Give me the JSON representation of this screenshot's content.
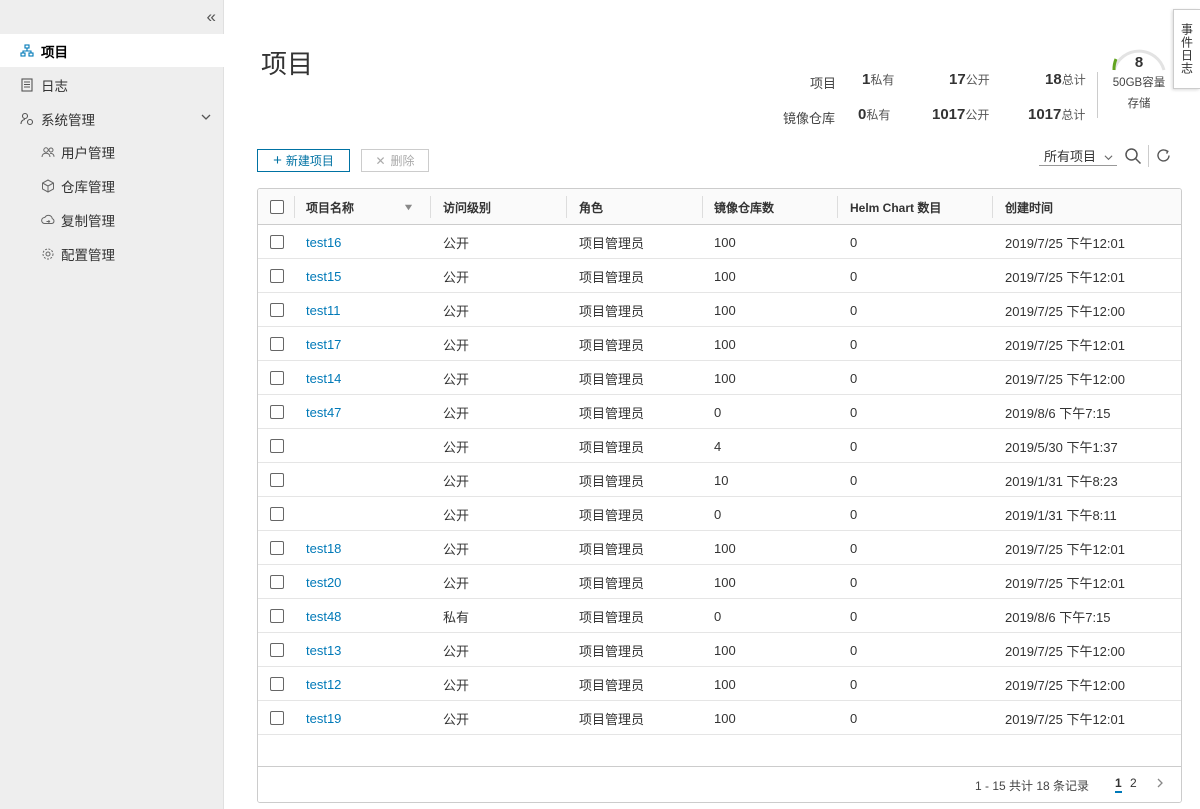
{
  "sidebar": {
    "items": [
      {
        "label": "项目",
        "icon": "projects-icon"
      },
      {
        "label": "日志",
        "icon": "logs-icon"
      },
      {
        "label": "系统管理",
        "icon": "system-admin-icon"
      }
    ],
    "sub_items": [
      {
        "label": "用户管理",
        "icon": "users-icon"
      },
      {
        "label": "仓库管理",
        "icon": "registry-icon"
      },
      {
        "label": "复制管理",
        "icon": "replication-icon"
      },
      {
        "label": "配置管理",
        "icon": "gear-icon"
      }
    ]
  },
  "page": {
    "title": "项目"
  },
  "stats": {
    "projects_label": "项目",
    "repos_label": "镜像仓库",
    "projects": {
      "private": "1",
      "public": "17",
      "total": "18"
    },
    "repos": {
      "private": "0",
      "public": "1017",
      "total": "1017"
    },
    "unit_private": "私有",
    "unit_public": "公开",
    "unit_total": "总计"
  },
  "storage": {
    "value": "8",
    "capacity": "50GB容量",
    "label": "存储",
    "accent": "#62a420"
  },
  "side_tab": "事件日志",
  "toolbar": {
    "new_label": "新建项目",
    "delete_label": "删除",
    "filter_value": "所有项目"
  },
  "table": {
    "headers": [
      "项目名称",
      "访问级别",
      "角色",
      "镜像仓库数",
      "Helm Chart 数目",
      "创建时间"
    ],
    "rows": [
      {
        "name": "test16",
        "access": "公开",
        "role": "项目管理员",
        "repos": "100",
        "charts": "0",
        "created": "2019/7/25 下午12:01"
      },
      {
        "name": "test15",
        "access": "公开",
        "role": "项目管理员",
        "repos": "100",
        "charts": "0",
        "created": "2019/7/25 下午12:01"
      },
      {
        "name": "test11",
        "access": "公开",
        "role": "项目管理员",
        "repos": "100",
        "charts": "0",
        "created": "2019/7/25 下午12:00"
      },
      {
        "name": "test17",
        "access": "公开",
        "role": "项目管理员",
        "repos": "100",
        "charts": "0",
        "created": "2019/7/25 下午12:01"
      },
      {
        "name": "test14",
        "access": "公开",
        "role": "项目管理员",
        "repos": "100",
        "charts": "0",
        "created": "2019/7/25 下午12:00"
      },
      {
        "name": "test47",
        "access": "公开",
        "role": "项目管理员",
        "repos": "0",
        "charts": "0",
        "created": "2019/8/6 下午7:15"
      },
      {
        "name": "",
        "access": "公开",
        "role": "项目管理员",
        "repos": "4",
        "charts": "0",
        "created": "2019/5/30 下午1:37"
      },
      {
        "name": "",
        "access": "公开",
        "role": "项目管理员",
        "repos": "10",
        "charts": "0",
        "created": "2019/1/31 下午8:23"
      },
      {
        "name": "",
        "access": "公开",
        "role": "项目管理员",
        "repos": "0",
        "charts": "0",
        "created": "2019/1/31 下午8:11"
      },
      {
        "name": "test18",
        "access": "公开",
        "role": "项目管理员",
        "repos": "100",
        "charts": "0",
        "created": "2019/7/25 下午12:01"
      },
      {
        "name": "test20",
        "access": "公开",
        "role": "项目管理员",
        "repos": "100",
        "charts": "0",
        "created": "2019/7/25 下午12:01"
      },
      {
        "name": "test48",
        "access": "私有",
        "role": "项目管理员",
        "repos": "0",
        "charts": "0",
        "created": "2019/8/6 下午7:15"
      },
      {
        "name": "test13",
        "access": "公开",
        "role": "项目管理员",
        "repos": "100",
        "charts": "0",
        "created": "2019/7/25 下午12:00"
      },
      {
        "name": "test12",
        "access": "公开",
        "role": "项目管理员",
        "repos": "100",
        "charts": "0",
        "created": "2019/7/25 下午12:00"
      },
      {
        "name": "test19",
        "access": "公开",
        "role": "项目管理员",
        "repos": "100",
        "charts": "0",
        "created": "2019/7/25 下午12:01"
      }
    ]
  },
  "pagination": {
    "summary": "1 - 15 共计 18 条记录",
    "pages": [
      "1",
      "2"
    ],
    "current": "1"
  }
}
